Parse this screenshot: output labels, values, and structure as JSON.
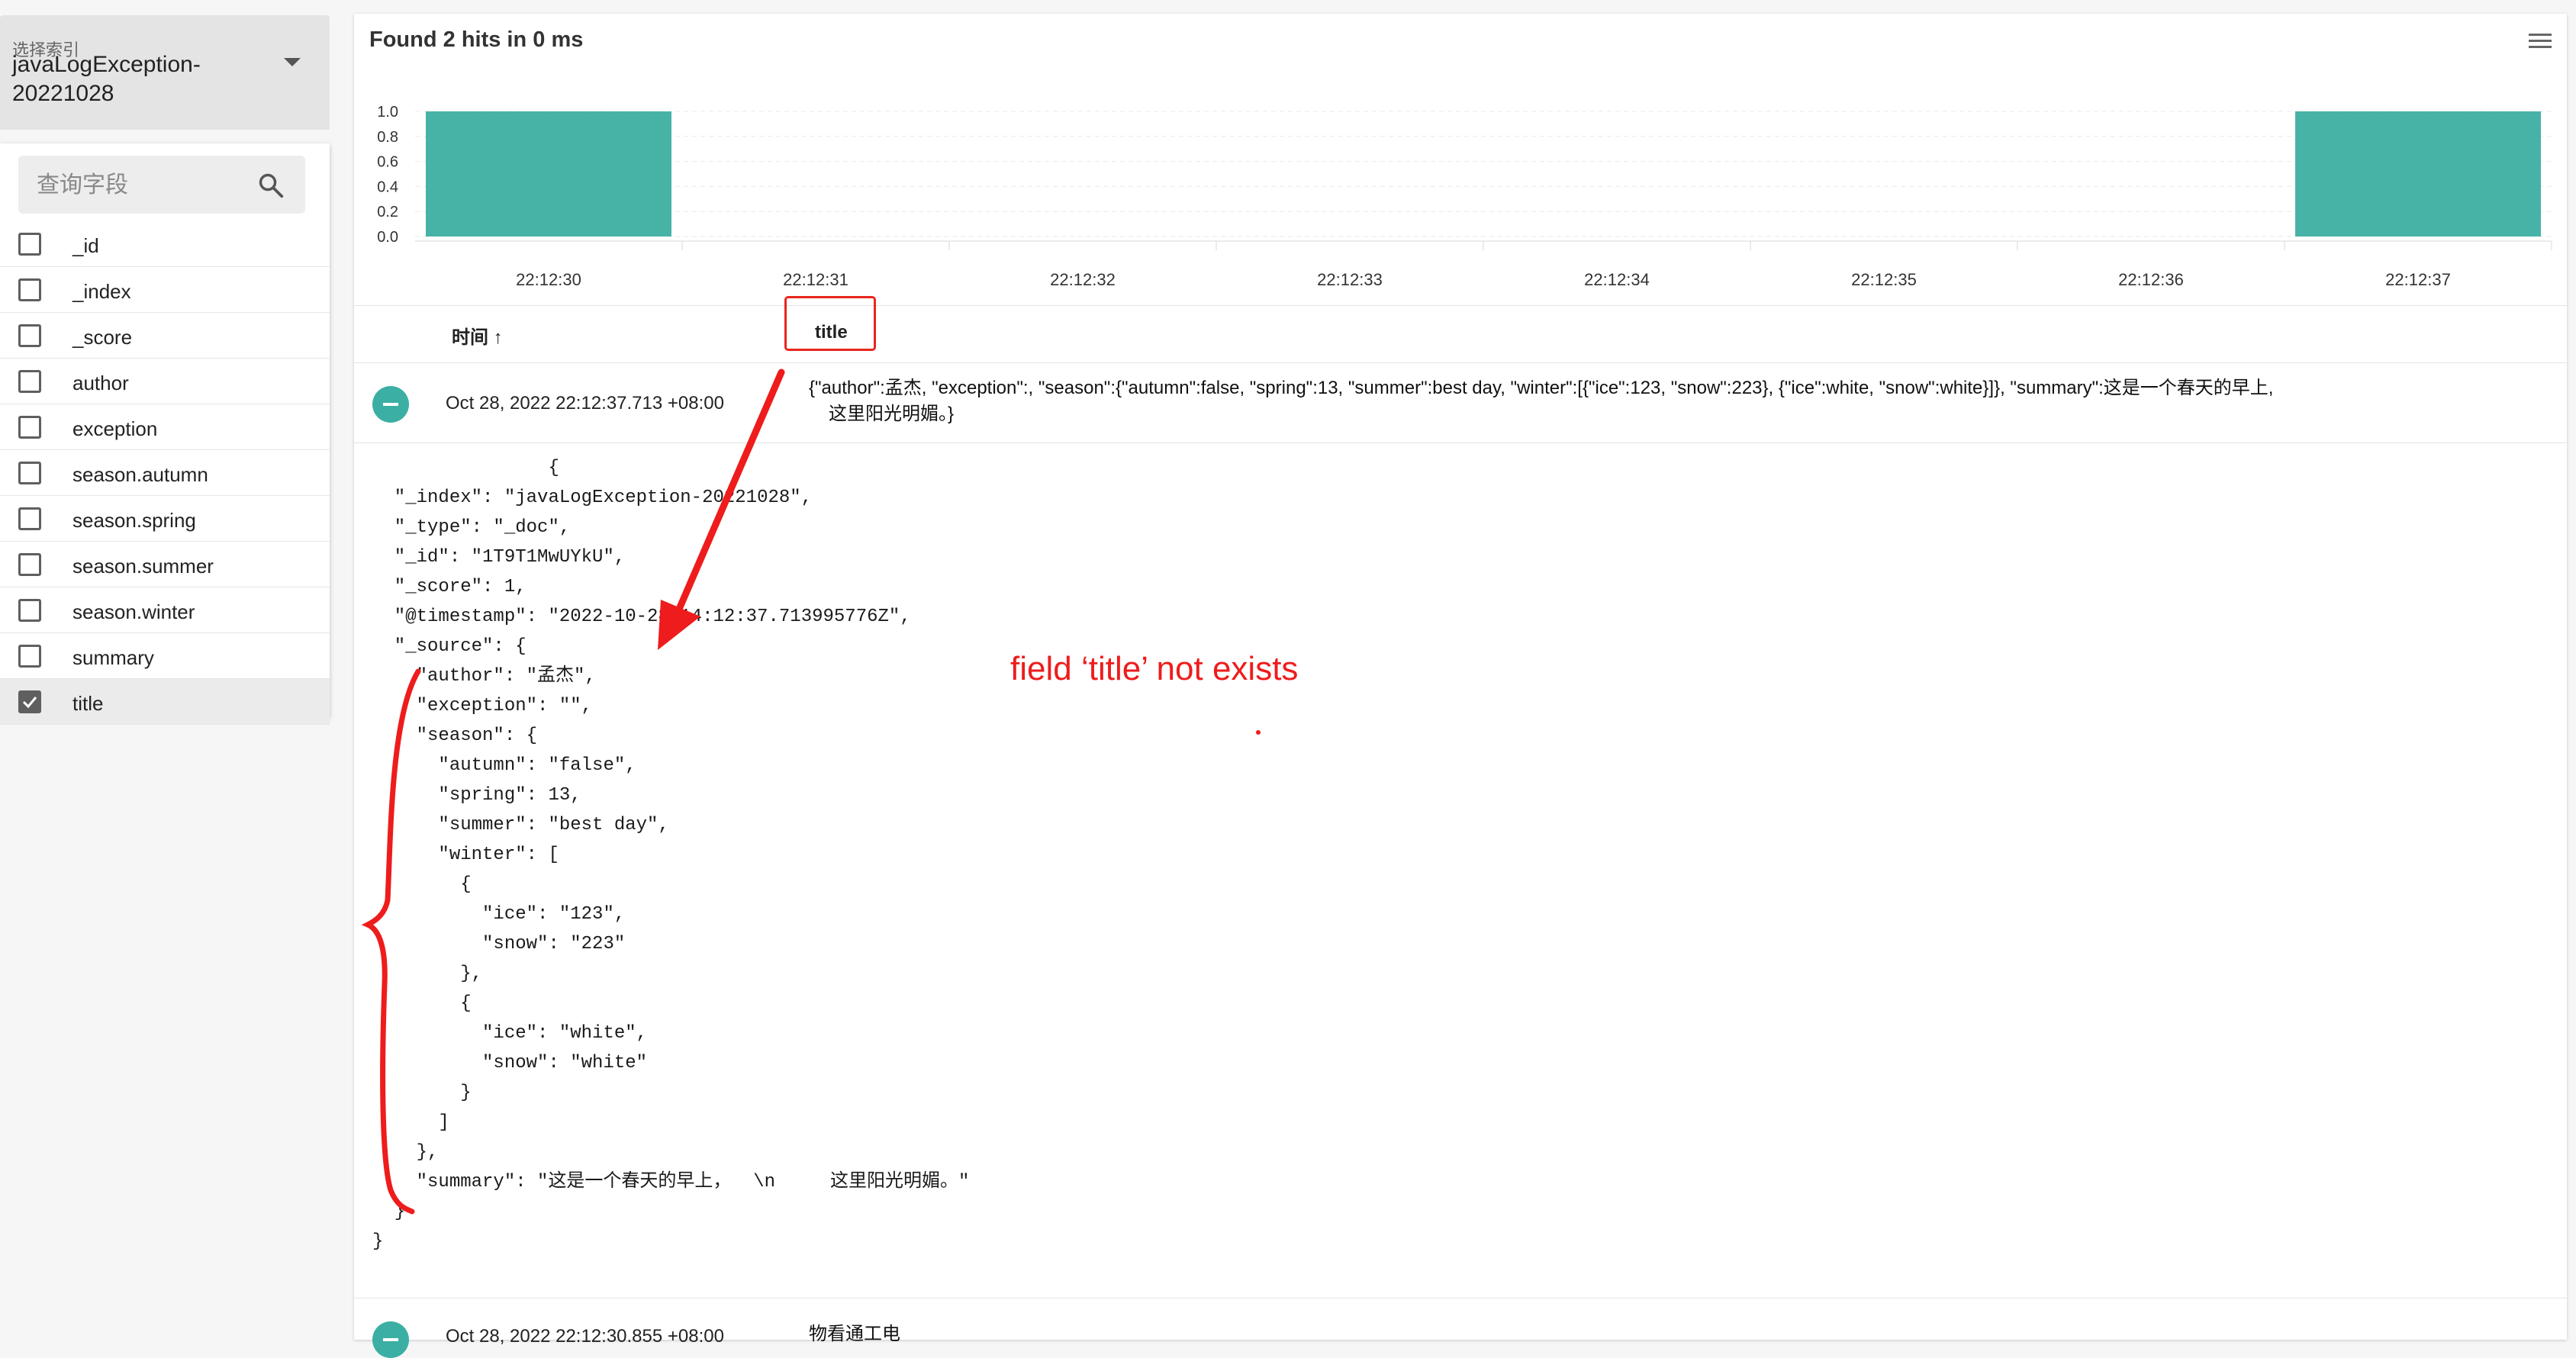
{
  "sidebar": {
    "index_label": "选择索引",
    "index_value": "javaLogException-20221028",
    "search_placeholder": "查询字段",
    "fields": [
      "_id",
      "_index",
      "_score",
      "author",
      "exception",
      "season.autumn",
      "season.spring",
      "season.summer",
      "season.winter",
      "summary",
      "title"
    ],
    "checked_field": "title",
    "icons": {
      "search": "search-icon",
      "dropdown": "caret-down-icon",
      "checkbox": "checkbox-icon"
    }
  },
  "results": {
    "hits_text": "Found 2 hits in 0 ms",
    "menu_icon": "hamburger-menu-icon",
    "columns": {
      "time": "时间 ↑",
      "title": "title"
    },
    "rows": [
      {
        "time": "Oct 28, 2022 22:12:37.713 +08:00",
        "summary_line1": "{\"author\":孟杰, \"exception\":, \"season\":{\"autumn\":false, \"spring\":13, \"summer\":best day, \"winter\":[{\"ice\":123, \"snow\":223}, {\"ice\":white, \"snow\":white}]}, \"summary\":这是一个春天的早上,",
        "summary_line2": "这里阳光明媚。}"
      },
      {
        "time": "Oct 28, 2022 22:12:30.855 +08:00",
        "summary_line1": "物看通工电",
        "summary_line2": ""
      }
    ],
    "expanded_json": [
      "                {",
      "  \"_index\": \"javaLogException-20221028\",",
      "  \"_type\": \"_doc\",",
      "  \"_id\": \"1T9T1MwUYkU\",",
      "  \"_score\": 1,",
      "  \"@timestamp\": \"2022-10-28T14:12:37.713995776Z\",",
      "  \"_source\": {",
      "    \"author\": \"孟杰\",",
      "    \"exception\": \"\",",
      "    \"season\": {",
      "      \"autumn\": \"false\",",
      "      \"spring\": 13,",
      "      \"summer\": \"best day\",",
      "      \"winter\": [",
      "        {",
      "          \"ice\": \"123\",",
      "          \"snow\": \"223\"",
      "        },",
      "        {",
      "          \"ice\": \"white\",",
      "          \"snow\": \"white\"",
      "        }",
      "      ]",
      "    },",
      "    \"summary\": \"这是一个春天的早上，  \\n     这里阳光明媚。\"",
      "  }",
      "}"
    ]
  },
  "annotation": {
    "text": "field ‘title’ not exists",
    "color": "#ee1c1c"
  },
  "colors": {
    "accent": "#47b3a7",
    "annotation_red": "#ee1c1c"
  },
  "chart_data": {
    "type": "bar",
    "categories": [
      "22:12:30",
      "22:12:31",
      "22:12:32",
      "22:12:33",
      "22:12:34",
      "22:12:35",
      "22:12:36",
      "22:12:37"
    ],
    "values": [
      1,
      0,
      0,
      0,
      0,
      0,
      0,
      1
    ],
    "y_ticks": [
      "0.0",
      "0.2",
      "0.4",
      "0.6",
      "0.8",
      "1.0"
    ],
    "ylim": [
      0,
      1
    ],
    "grid": true,
    "bar_color": "#47b3a7"
  }
}
